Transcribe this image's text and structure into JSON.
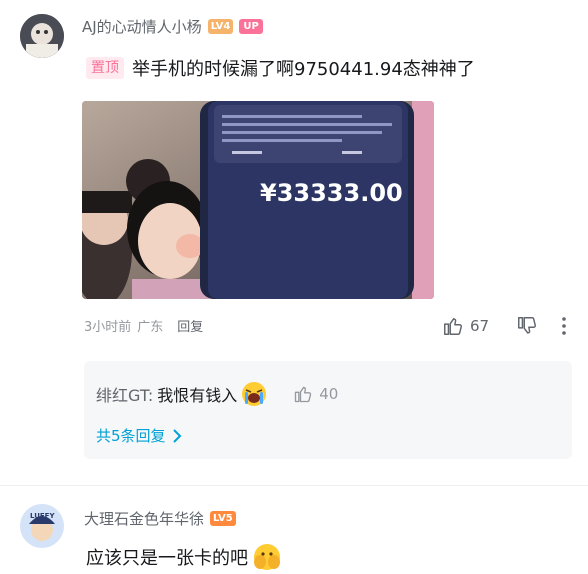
{
  "comment1": {
    "username": "AJ的心动情人小杨",
    "level_badge": "LV4",
    "up_badge": "UP",
    "pin_label": "置顶",
    "text": "举手机的时候漏了啊9750441.94态神神了",
    "image": {
      "phone_amount": "¥33333.00"
    },
    "time": "3小时前",
    "location": "广东",
    "reply_label": "回复",
    "like_count": "67"
  },
  "reply_preview": {
    "author": "绯红GT:",
    "text": "我恨有钱入",
    "like_count": "40",
    "more_label": "共5条回复"
  },
  "comment2": {
    "username": "大理石金色年华徐",
    "level_badge": "LV5",
    "avatar_text": "LUFFY",
    "text": "应该只是一张卡的吧"
  },
  "colors": {
    "pink": "#fb7299",
    "blue": "#00a1d6",
    "level_orange": "#f5b36b",
    "meta_gray": "#9499a0"
  },
  "icons": [
    "thumb-up-icon",
    "thumb-down-icon",
    "more-vertical-icon",
    "chevron-right-icon",
    "crying-emoji-icon",
    "covering-face-emoji-icon"
  ]
}
